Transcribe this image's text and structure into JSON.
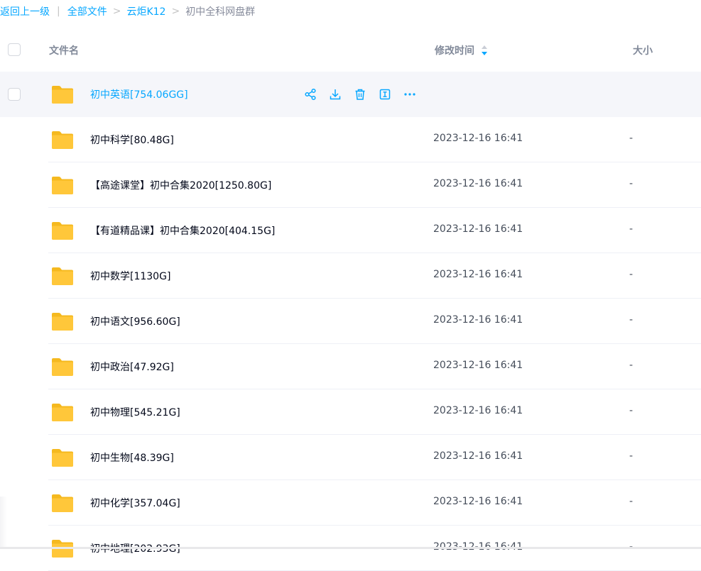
{
  "breadcrumb": {
    "back": "返回上一级",
    "separator": "|",
    "root": "全部文件",
    "level1": "云炬K12",
    "chevron": ">",
    "current": "初中全科网盘群"
  },
  "header": {
    "name": "文件名",
    "time": "修改时间",
    "size": "大小",
    "sort_icon": "sort-desc-icon"
  },
  "colors": {
    "accent": "#06a7ff",
    "folder": "#ffc73a",
    "selected_row": "#f5f6fa"
  },
  "files": [
    {
      "name": "初中英语[754.06GG]",
      "time": "",
      "size": "",
      "selected": true
    },
    {
      "name": "初中科学[80.48G]",
      "time": "2023-12-16 16:41",
      "size": "-"
    },
    {
      "name": "【高途课堂】初中合集2020[1250.80G]",
      "time": "2023-12-16 16:41",
      "size": "-"
    },
    {
      "name": "【有道精品课】初中合集2020[404.15G]",
      "time": "2023-12-16 16:41",
      "size": "-"
    },
    {
      "name": "初中数学[1130G]",
      "time": "2023-12-16 16:41",
      "size": "-"
    },
    {
      "name": "初中语文[956.60G]",
      "time": "2023-12-16 16:41",
      "size": "-"
    },
    {
      "name": "初中政治[47.92G]",
      "time": "2023-12-16 16:41",
      "size": "-"
    },
    {
      "name": "初中物理[545.21G]",
      "time": "2023-12-16 16:41",
      "size": "-"
    },
    {
      "name": "初中生物[48.39G]",
      "time": "2023-12-16 16:41",
      "size": "-"
    },
    {
      "name": "初中化学[357.04G]",
      "time": "2023-12-16 16:41",
      "size": "-"
    },
    {
      "name": "初中地理[202.93G]",
      "time": "2023-12-16 16:41",
      "size": "-"
    }
  ],
  "row_actions": [
    "share-icon",
    "download-icon",
    "delete-icon",
    "rename-icon",
    "more-icon"
  ]
}
